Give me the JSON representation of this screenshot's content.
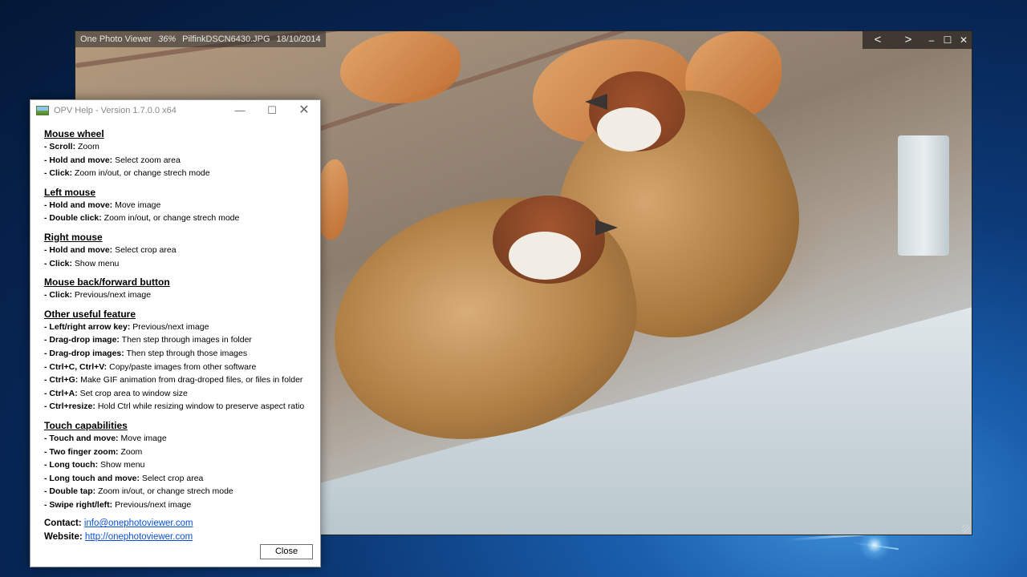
{
  "viewer": {
    "app_name": "One Photo Viewer",
    "zoom": "36%",
    "filename": "PilfinkDSCN6430.JPG",
    "date": "18/10/2014",
    "controls": {
      "prev": "<",
      "next": ">",
      "minimize": "–",
      "maximize": "☐",
      "close": "✕"
    }
  },
  "dialog": {
    "title": "OPV Help - Version 1.7.0.0 x64",
    "window_buttons": {
      "minimize": "—",
      "maximize": "☐",
      "close": "✕"
    },
    "sections": [
      {
        "title": "Mouse wheel",
        "items": [
          {
            "key": "- Scroll:",
            "desc": " Zoom"
          },
          {
            "key": "- Hold and move:",
            "desc": " Select zoom area"
          },
          {
            "key": "- Click:",
            "desc": " Zoom in/out, or change strech mode"
          }
        ]
      },
      {
        "title": "Left mouse",
        "items": [
          {
            "key": "- Hold and move:",
            "desc": " Move image"
          },
          {
            "key": "- Double click:",
            "desc": " Zoom in/out, or change strech mode"
          }
        ]
      },
      {
        "title": "Right mouse",
        "items": [
          {
            "key": "- Hold and move:",
            "desc": " Select crop area"
          },
          {
            "key": "- Click:",
            "desc": " Show menu"
          }
        ]
      },
      {
        "title": "Mouse back/forward button",
        "items": [
          {
            "key": "- Click:",
            "desc": " Previous/next image"
          }
        ]
      },
      {
        "title": "Other useful feature",
        "items": [
          {
            "key": "- Left/right arrow key:",
            "desc": " Previous/next image"
          },
          {
            "key": "- Drag-drop image:",
            "desc": " Then step through images in folder"
          },
          {
            "key": "- Drag-drop images:",
            "desc": " Then step through those images"
          },
          {
            "key": "- Ctrl+C, Ctrl+V:",
            "desc": " Copy/paste images from other software"
          },
          {
            "key": "- Ctrl+G:",
            "desc": " Make GIF animation from drag-droped files, or files in folder"
          },
          {
            "key": "- Ctrl+A:",
            "desc": " Set crop area to window size"
          },
          {
            "key": "- Ctrl+resize:",
            "desc": " Hold Ctrl while resizing window to preserve aspect ratio"
          }
        ]
      },
      {
        "title": "Touch capabilities",
        "items": [
          {
            "key": "- Touch and move:",
            "desc": " Move image"
          },
          {
            "key": "- Two finger zoom:",
            "desc": " Zoom"
          },
          {
            "key": "- Long touch:",
            "desc": " Show menu"
          },
          {
            "key": "- Long touch and move:",
            "desc": " Select crop area"
          },
          {
            "key": "- Double tap:",
            "desc": " Zoom in/out, or change strech mode"
          },
          {
            "key": "- Swipe right/left:",
            "desc": " Previous/next image"
          }
        ]
      }
    ],
    "contact_label": "Contact:",
    "contact_email": "info@onephotoviewer.com",
    "website_label": "Website:",
    "website_url": "http://onephotoviewer.com",
    "close_label": "Close"
  },
  "colors": {
    "link": "#0a4fd6",
    "desktop_blue": "#0c3a78"
  }
}
